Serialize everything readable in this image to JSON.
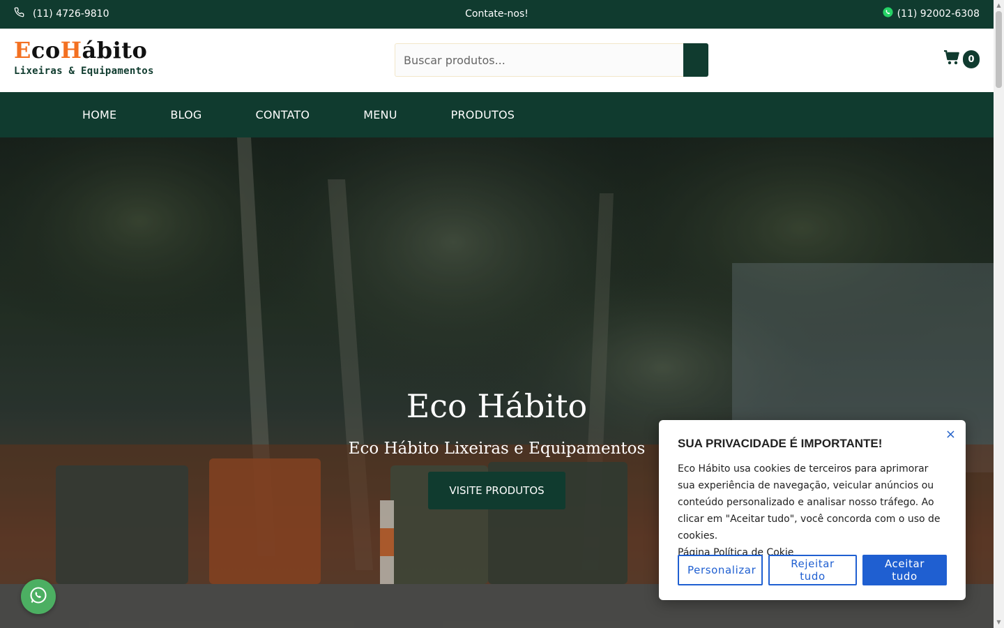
{
  "topbar": {
    "phone": "(11) 4726-9810",
    "contact": "Contate-nos!",
    "whatsapp": "(11) 92002-6308",
    "phone_icon": "phone-icon",
    "whatsapp_icon": "whatsapp-icon"
  },
  "logo": {
    "eco_e": "E",
    "eco_rest": "co",
    "habito_h": "H",
    "habito_rest": "ábito",
    "subtitle": "Lixeiras & Equipamentos"
  },
  "search": {
    "placeholder": "Buscar produtos...",
    "icon": "search-icon"
  },
  "cart": {
    "count": "0",
    "icon": "cart-icon"
  },
  "nav": {
    "items": [
      {
        "label": "HOME"
      },
      {
        "label": "BLOG"
      },
      {
        "label": "CONTATO"
      },
      {
        "label": "MENU"
      },
      {
        "label": "PRODUTOS"
      }
    ]
  },
  "hero": {
    "title": "Eco Hábito",
    "subtitle": "Eco Hábito Lixeiras e Equipamentos",
    "button": "VISITE PRODUTOS"
  },
  "cookie": {
    "title": "SUA PRIVACIDADE É IMPORTANTE!",
    "text": "Eco Hábito usa cookies de terceiros para aprimorar sua experiência de navegação, veicular anúncios ou conteúdo personalizado e analisar nosso tráfego. Ao clicar em \"Aceitar tudo\", você concorda com o uso de cookies.",
    "policy_link": "Página Política de Cokie",
    "close": "×",
    "buttons": {
      "customize": "Personalizar",
      "reject": "Rejeitar tudo",
      "accept": "Aceitar tudo"
    }
  },
  "colors": {
    "brand_dark_green": "#103b2f",
    "logo_orange": "#f37021",
    "cookie_blue": "#1f5fd1",
    "whatsapp_green": "#4caf62"
  }
}
